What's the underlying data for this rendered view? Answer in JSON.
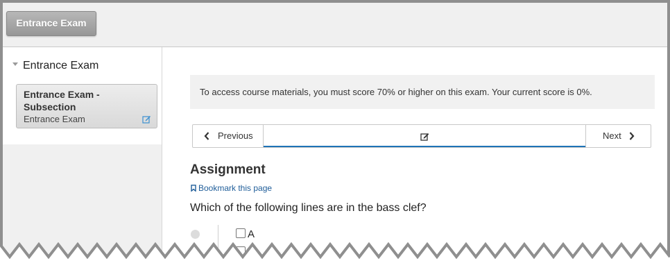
{
  "topbar": {
    "tab_label": "Entrance Exam"
  },
  "sidebar": {
    "chapter_label": "Entrance Exam",
    "subsection": {
      "title": "Entrance Exam - Subsection",
      "meta": "Entrance Exam"
    }
  },
  "main": {
    "notice": "To access course materials, you must score 70% or higher on this exam. Your current score is 0%.",
    "nav": {
      "previous_label": "Previous",
      "next_label": "Next"
    },
    "problem_title": "Assignment",
    "bookmark_label": "Bookmark this page",
    "question": "Which of the following lines are in the bass clef?",
    "choices": [
      "A",
      "B"
    ]
  },
  "icons": {
    "edit": "edit-icon",
    "chevron_left": "chevron-left-icon",
    "chevron_right": "chevron-right-icon",
    "bookmark": "bookmark-icon"
  },
  "colors": {
    "accent": "#1f73b7",
    "link": "#1f5d99",
    "tab_gray": "#a8a8a8"
  }
}
